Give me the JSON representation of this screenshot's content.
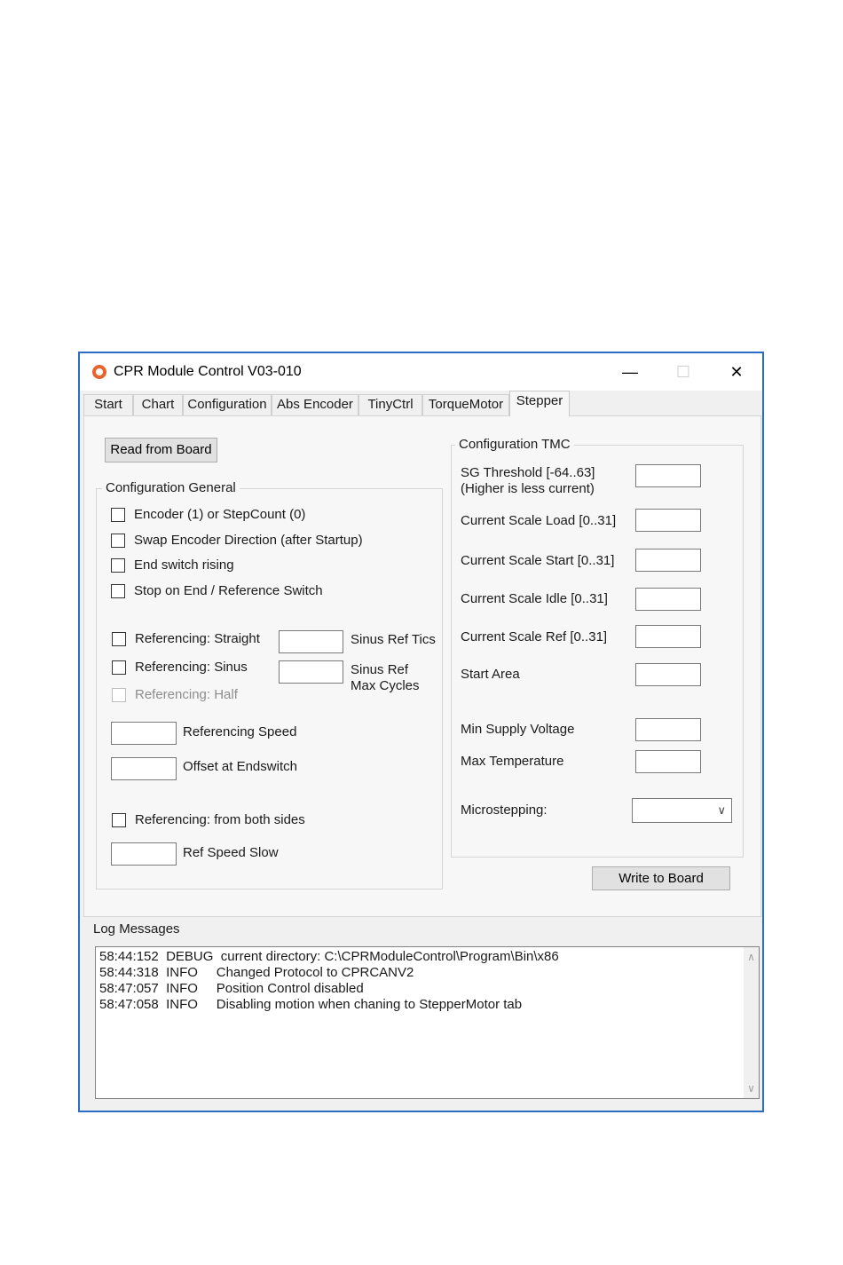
{
  "window": {
    "title": "CPR Module Control V03-010",
    "minimize": "—",
    "maximize": "☐",
    "close": "✕"
  },
  "tabs": [
    "Start",
    "Chart",
    "Configuration",
    "Abs Encoder",
    "TinyCtrl",
    "TorqueMotor",
    "Stepper"
  ],
  "active_tab": "Stepper",
  "stepper": {
    "read_button": "Read from Board",
    "write_button": "Write to Board",
    "general": {
      "title": "Configuration General",
      "encoder": "Encoder (1) or StepCount (0)",
      "swap": "Swap Encoder Direction (after Startup)",
      "endswitch": "End switch rising",
      "stop": "Stop on End / Reference Switch",
      "ref_straight": "Referencing: Straight",
      "ref_sinus": "Referencing: Sinus",
      "ref_half": "Referencing: Half",
      "sinus_tics": "Sinus Ref Tics",
      "sinus_max_1": "Sinus Ref",
      "sinus_max_2": "Max Cycles",
      "ref_speed": "Referencing Speed",
      "offset": "Offset at Endswitch",
      "ref_both": "Referencing: from both sides",
      "ref_slow": "Ref Speed Slow"
    },
    "tmc": {
      "title": "Configuration TMC",
      "sg_1": "SG Threshold [-64..63]",
      "sg_2": "(Higher is less current)",
      "load": "Current Scale Load [0..31]",
      "start": "Current Scale Start [0..31]",
      "idle": "Current Scale Idle [0..31]",
      "ref": "Current Scale Ref [0..31]",
      "start_area": "Start Area",
      "min_supply": "Min Supply Voltage",
      "max_temp": "Max Temperature",
      "micro": "Microstepping:"
    }
  },
  "log": {
    "title": "Log Messages",
    "lines": [
      "58:44:152  DEBUG  current directory: C:\\CPRModuleControl\\Program\\Bin\\x86",
      "58:44:318  INFO     Changed Protocol to CPRCANV2",
      "58:47:057  INFO     Position Control disabled",
      "58:47:058  INFO     Disabling motion when chaning to StepperMotor tab"
    ]
  }
}
